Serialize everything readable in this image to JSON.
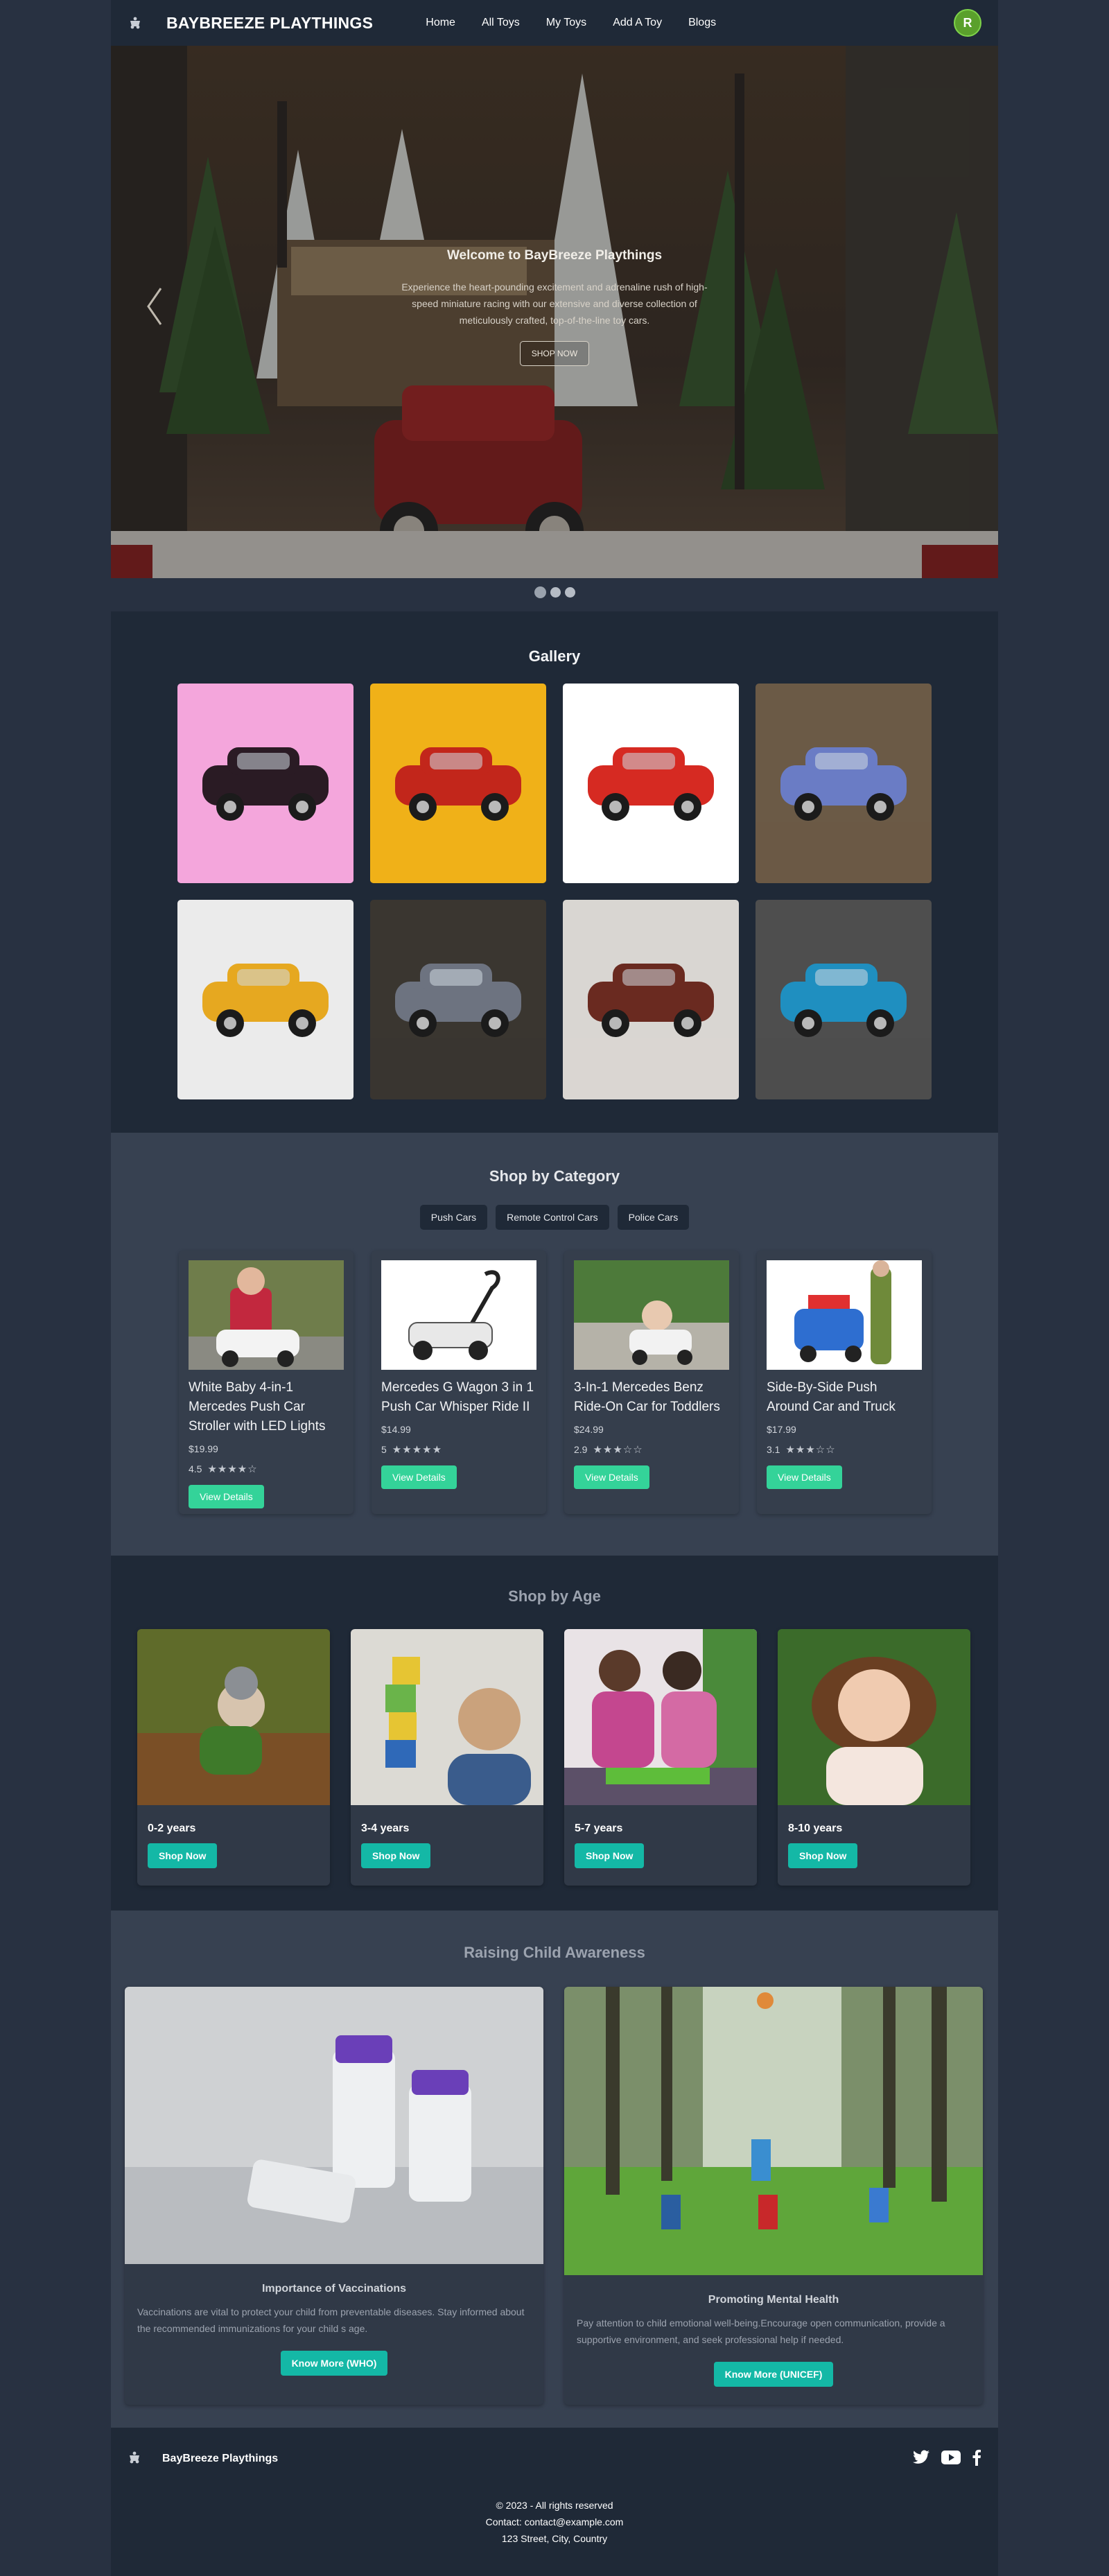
{
  "nav": {
    "brand": "BAYBREEZE PLAYTHINGS",
    "links": [
      "Home",
      "All Toys",
      "My Toys",
      "Add A Toy",
      "Blogs"
    ],
    "avatar_initial": "R",
    "logo_icon": "toy-logo-icon"
  },
  "hero": {
    "title": "Welcome to BayBreeze Playthings",
    "description": "Experience the heart-pounding excitement and adrenaline rush of high-speed miniature racing with our extensive and diverse collection of meticulously crafted, top-of-the-line toy cars.",
    "button": "SHOP NOW",
    "slides_total": 3,
    "active_slide": 1
  },
  "gallery": {
    "title": "Gallery",
    "images": [
      {
        "name": "black-convertible",
        "bg": "#f4a6dc",
        "car": "#2a1b24"
      },
      {
        "name": "red-racer-yellow",
        "bg": "#f0b118",
        "car": "#c2261b"
      },
      {
        "name": "red-beetle",
        "bg": "#ffffff",
        "car": "#d62a22"
      },
      {
        "name": "lego-atv",
        "bg": "#6b5a46",
        "car": "#6a7cc5"
      },
      {
        "name": "yellow-fiat",
        "bg": "#ebebeb",
        "car": "#e6a820"
      },
      {
        "name": "racing-car-dark",
        "bg": "#3a3630",
        "car": "#6d7380"
      },
      {
        "name": "super-van",
        "bg": "#d9d6d2",
        "car": "#6a2a20"
      },
      {
        "name": "hot-wheels-blue",
        "bg": "#4e4e4e",
        "car": "#1f8fc0"
      }
    ]
  },
  "category": {
    "title": "Shop by Category",
    "tabs": [
      "Push Cars",
      "Remote Control Cars",
      "Police Cars"
    ],
    "products": [
      {
        "name": "White Baby 4-in-1 Mercedes Push Car Stroller with LED Lights",
        "price": "$19.99",
        "rating": "4.5",
        "stars": "★★★★☆",
        "button": "View Details"
      },
      {
        "name": "Mercedes G Wagon 3 in 1 Push Car Whisper Ride II",
        "price": "$14.99",
        "rating": "5",
        "stars": "★★★★★",
        "button": "View Details"
      },
      {
        "name": "3-In-1 Mercedes Benz Ride-On Car for Toddlers",
        "price": "$24.99",
        "rating": "2.9",
        "stars": "★★★☆☆",
        "button": "View Details"
      },
      {
        "name": "Side-By-Side Push Around Car and Truck",
        "price": "$17.99",
        "rating": "3.1",
        "stars": "★★★☆☆",
        "button": "View Details"
      }
    ]
  },
  "age": {
    "title": "Shop by Age",
    "groups": [
      {
        "label": "0-2 years",
        "button": "Shop Now"
      },
      {
        "label": "3-4 years",
        "button": "Shop Now"
      },
      {
        "label": "5-7 years",
        "button": "Shop Now"
      },
      {
        "label": "8-10 years",
        "button": "Shop Now"
      }
    ]
  },
  "awareness": {
    "title": "Raising Child Awareness",
    "cards": [
      {
        "title": "Importance of Vaccinations",
        "text": "Vaccinations are vital to protect your child from preventable diseases. Stay informed about the recommended immunizations for your child s age.",
        "button": "Know More (WHO)"
      },
      {
        "title": "Promoting Mental Health",
        "text": "Pay attention to child emotional well-being.Encourage open communication, provide a supportive environment, and seek professional help if needed.",
        "button": "Know More (UNICEF)"
      }
    ]
  },
  "footer": {
    "brand": "BayBreeze Playthings",
    "copyright": "© 2023 - All rights reserved",
    "contact": "Contact: contact@example.com",
    "address": "123 Street, City, Country",
    "socials": [
      "twitter-icon",
      "youtube-icon",
      "facebook-icon"
    ]
  },
  "colors": {
    "nav_bg": "#1f2937",
    "section_mid": "#374151",
    "accent_green": "#34d399",
    "accent_teal": "#14b8a6",
    "avatar": "#5aa02c"
  }
}
